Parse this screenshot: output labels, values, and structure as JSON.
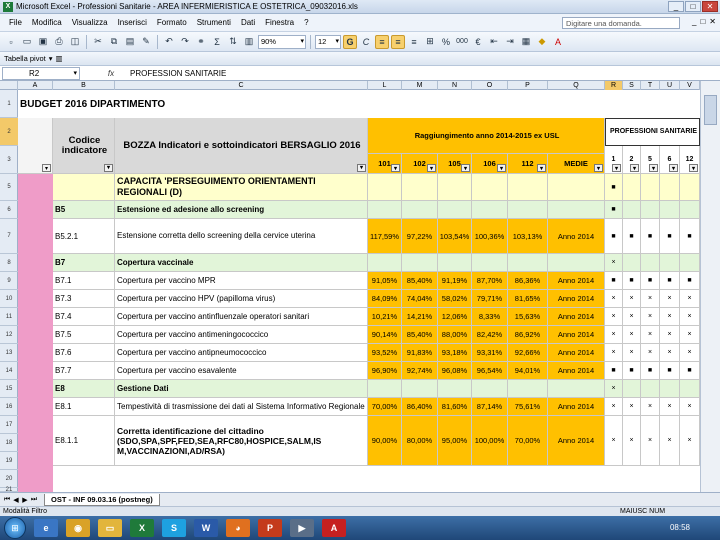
{
  "window": {
    "title": "Microsoft Excel - Professioni Sanitarie - AREA INFERMIERISTICA E OSTETRICA_09032016.xls",
    "min": "_",
    "max": "□",
    "close": "✕"
  },
  "menu": {
    "items": [
      "File",
      "Modifica",
      "Visualizza",
      "Inserisci",
      "Formato",
      "Strumenti",
      "Dati",
      "Finestra",
      "?"
    ],
    "ask_placeholder": "Digitare una domanda."
  },
  "toolbar": {
    "zoom": "90%",
    "font_size": "12",
    "bold": "G",
    "italic": "C",
    "percent": "%",
    "thousands": "000",
    "euro": "€"
  },
  "toolbar2": {
    "pivot_label": "Tabella pivot"
  },
  "formula_bar": {
    "cell_ref": "R2",
    "fx": "fx",
    "value": "PROFESSION SANITARIE"
  },
  "columns": [
    "A",
    "B",
    "C",
    "L",
    "M",
    "N",
    "O",
    "P",
    "Q",
    "R",
    "S",
    "T",
    "U",
    "V"
  ],
  "row_numbers": [
    "1",
    "2",
    "3",
    "5",
    "6",
    "7",
    "8",
    "9",
    "10",
    "11",
    "12",
    "13",
    "14",
    "15",
    "16",
    "17",
    "18",
    "19",
    "20",
    "21"
  ],
  "sheet": {
    "title": "BUDGET 2016 DIPARTIMENTO",
    "hdr_code": "Codice indicatore",
    "hdr_desc": "BOZZA Indicatori e sottoindicatori BERSAGLIO 2016",
    "hdr_target": "Raggiungimento anno 2014-2015 ex USL",
    "hdr_prof": "PROFESSIONI SANITARIE",
    "sub_cols": [
      "101",
      "102",
      "105",
      "106",
      "112",
      "MEDIE"
    ],
    "prof_cols": [
      "1",
      "2",
      "5",
      "6",
      "12"
    ],
    "rows": [
      {
        "code": "",
        "desc": "CAPACITA 'PERSEGUIMENTO ORIENTAMENTI REGIONALI (D)",
        "vals": [
          "",
          "",
          "",
          "",
          "",
          ""
        ],
        "flags": [
          "■",
          "",
          "",
          "",
          ""
        ],
        "type": "section"
      },
      {
        "code": "B5",
        "desc": "Estensione ed adesione allo screening",
        "vals": [
          "",
          "",
          "",
          "",
          "",
          ""
        ],
        "flags": [
          "■",
          "",
          "",
          "",
          ""
        ],
        "type": "group"
      },
      {
        "code": "B5.2.1",
        "desc": "Estensione corretta dello screening della cervice uterina",
        "vals": [
          "117,59%",
          "97,22%",
          "103,54%",
          "100,36%",
          "103,13%",
          "Anno 2014"
        ],
        "flags": [
          "■",
          "■",
          "■",
          "■",
          "■"
        ],
        "type": "item"
      },
      {
        "code": "B7",
        "desc": "Copertura vaccinale",
        "vals": [
          "",
          "",
          "",
          "",
          "",
          ""
        ],
        "flags": [
          "×",
          "",
          "",
          "",
          ""
        ],
        "type": "group"
      },
      {
        "code": "B7.1",
        "desc": "Copertura per vaccino MPR",
        "vals": [
          "91,05%",
          "85,40%",
          "91,19%",
          "87,70%",
          "86,36%",
          "Anno 2014"
        ],
        "flags": [
          "■",
          "■",
          "■",
          "■",
          "■"
        ],
        "type": "item"
      },
      {
        "code": "B7.3",
        "desc": "Copertura per vaccino HPV (papilloma virus)",
        "vals": [
          "84,09%",
          "74,04%",
          "58,02%",
          "79,71%",
          "81,65%",
          "Anno 2014"
        ],
        "flags": [
          "×",
          "×",
          "×",
          "×",
          "×"
        ],
        "type": "item"
      },
      {
        "code": "B7.4",
        "desc": "Copertura per vaccino antinfluenzale operatori sanitari",
        "vals": [
          "10,21%",
          "14,21%",
          "12,06%",
          "8,33%",
          "15,63%",
          "Anno 2014"
        ],
        "flags": [
          "×",
          "×",
          "×",
          "×",
          "×"
        ],
        "type": "item"
      },
      {
        "code": "B7.5",
        "desc": "Copertura per vaccino antimeningococcico",
        "vals": [
          "90,14%",
          "85,40%",
          "88,00%",
          "82,42%",
          "86,92%",
          "Anno 2014"
        ],
        "flags": [
          "×",
          "×",
          "×",
          "×",
          "×"
        ],
        "type": "item"
      },
      {
        "code": "B7.6",
        "desc": "Copertura per vaccino antipneumococcico",
        "vals": [
          "93,52%",
          "91,83%",
          "93,18%",
          "93,31%",
          "92,66%",
          "Anno 2014"
        ],
        "flags": [
          "×",
          "×",
          "×",
          "×",
          "×"
        ],
        "type": "item"
      },
      {
        "code": "B7.7",
        "desc": "Copertura per vaccino esavalente",
        "vals": [
          "96,90%",
          "92,74%",
          "96,08%",
          "96,54%",
          "94,01%",
          "Anno 2014"
        ],
        "flags": [
          "■",
          "■",
          "■",
          "■",
          "■"
        ],
        "type": "item"
      },
      {
        "code": "E8",
        "desc": "Gestione Dati",
        "vals": [
          "",
          "",
          "",
          "",
          "",
          ""
        ],
        "flags": [
          "×",
          "",
          "",
          "",
          ""
        ],
        "type": "group"
      },
      {
        "code": "E8.1",
        "desc": "Tempestività di trasmissione dei dati al Sistema Informativo Regionale",
        "vals": [
          "70,00%",
          "86,40%",
          "81,60%",
          "87,14%",
          "75,61%",
          "Anno 2014"
        ],
        "flags": [
          "×",
          "×",
          "×",
          "×",
          "×"
        ],
        "type": "item"
      },
      {
        "code": "E8.1.1",
        "desc": "Corretta identificazione del cittadino (SDO,SPA,SPF,FED,SEA,RFC80,HOSPICE,SALM,IS M,VACCINAZIONI,AD/RSA)",
        "vals": [
          "90,00%",
          "80,00%",
          "95,00%",
          "100,00%",
          "70,00%",
          "Anno 2014"
        ],
        "flags": [
          "×",
          "×",
          "×",
          "×",
          "×"
        ],
        "type": "item"
      }
    ]
  },
  "tabs": {
    "active": "OST - INF 09.03.16 (postneg)"
  },
  "status": {
    "left": "Modalità Filtro",
    "right": "MAIUSC NUM"
  },
  "taskbar": {
    "clock": "08:58"
  }
}
